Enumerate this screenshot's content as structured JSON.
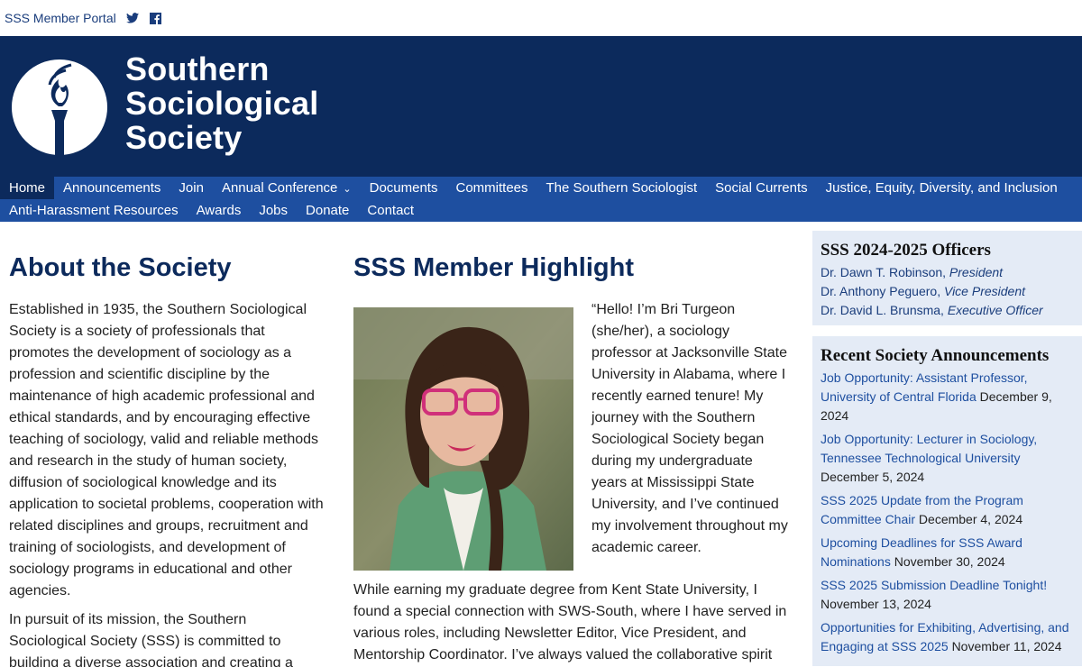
{
  "topbar": {
    "portal_label": "SSS Member Portal",
    "icons": [
      "twitter-icon",
      "facebook-icon"
    ]
  },
  "header": {
    "name_line1": "Southern",
    "name_line2": "Sociological",
    "name_line3": "Society",
    "bg_color": "#0c2a5c"
  },
  "nav": {
    "row1": [
      "Home",
      "Announcements",
      "Join",
      "Annual Conference",
      "Documents",
      "Committees",
      "The Southern Sociologist",
      "Social Currents",
      "Justice, Equity, Diversity, and Inclusion"
    ],
    "row2": [
      "Anti-Harassment Resources",
      "Awards",
      "Jobs",
      "Donate",
      "Contact"
    ],
    "active": "Home"
  },
  "about": {
    "title": "About the Society",
    "p1": "Established in 1935, the Southern Sociological Society is a society of professionals that promotes the development of sociology as a profession and scientific discipline by the maintenance of high academic professional and ethical standards, and by encouraging effective teaching of sociology, valid and reliable methods and research in the study of human society, diffusion of sociological knowledge and its application to societal problems, cooperation with related disciplines and groups, recruitment and training of sociologists, and development of sociology programs in educational and other agencies.",
    "p2": "In pursuit of its mission, the Southern Sociological Society (SSS) is committed to building a diverse association and creating a"
  },
  "highlight": {
    "title": "SSS Member Highlight",
    "p1": "“Hello! I’m Bri Turgeon (she/her), a sociology professor at Jacksonville State University in Alabama, where I recently earned tenure! My journey with the Southern Sociological Society began during my undergraduate years at Mississippi State University, and I’ve continued my involvement throughout my academic career.",
    "p2": "While earning my graduate degree from Kent State University, I found a special connection with SWS-South, where I have served in various roles, including Newsletter Editor, Vice President, and Mentorship Coordinator. I’ve always valued the collaborative spirit"
  },
  "officers": {
    "title": "SSS 2024-2025 Officers",
    "list": [
      {
        "name": "Dr. Dawn T. Robinson,",
        "role": "President"
      },
      {
        "name": "Dr. Anthony Peguero,",
        "role": "Vice President"
      },
      {
        "name": "Dr. David L. Brunsma,",
        "role": "Executive Officer"
      }
    ]
  },
  "announcements": {
    "title": "Recent Society Announcements",
    "items": [
      {
        "title": "Job Opportunity: Assistant Professor, University of Central Florida",
        "date": "December 9, 2024"
      },
      {
        "title": "Job Opportunity: Lecturer in Sociology, Tennessee Technological University",
        "date": "December 5, 2024"
      },
      {
        "title": "SSS 2025 Update from the Program Committee Chair",
        "date": "December 4, 2024"
      },
      {
        "title": "Upcoming Deadlines for SSS Award Nominations",
        "date": "November 30, 2024"
      },
      {
        "title": "SSS 2025 Submission Deadline Tonight!",
        "date": "November 13, 2024"
      },
      {
        "title": "Opportunities for Exhibiting, Advertising, and Engaging at SSS 2025",
        "date": "November 11, 2024"
      }
    ]
  }
}
